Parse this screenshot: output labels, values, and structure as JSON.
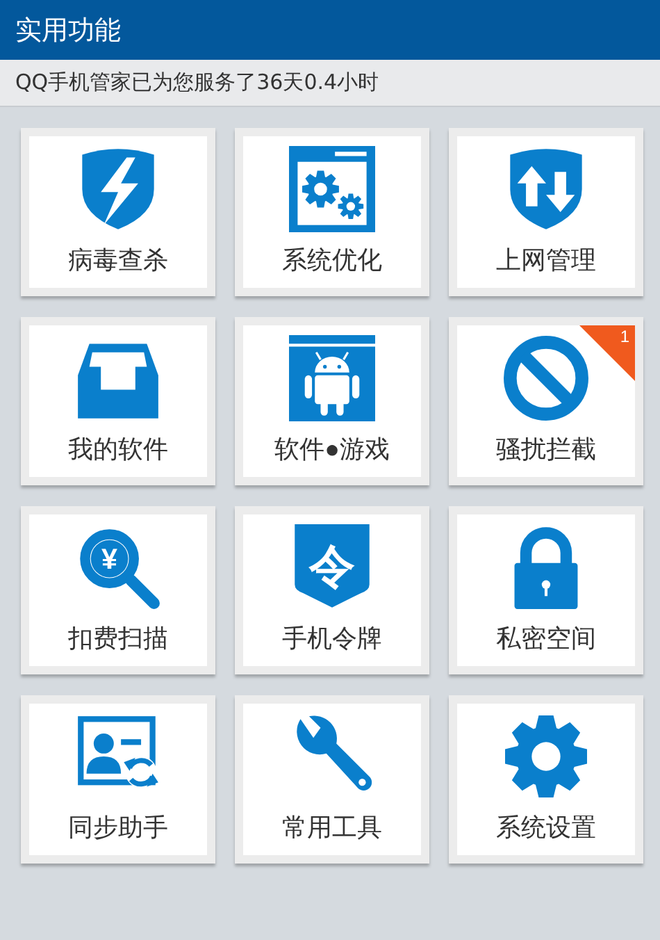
{
  "header": {
    "title": "实用功能"
  },
  "service_note": "QQ手机管家已为您服务了36天0.4小时",
  "tiles": [
    {
      "label": "病毒查杀"
    },
    {
      "label": "系统优化"
    },
    {
      "label": "上网管理"
    },
    {
      "label": "我的软件"
    },
    {
      "label": "软件●游戏"
    },
    {
      "label": "骚扰拦截",
      "badge": "1"
    },
    {
      "label": "扣费扫描",
      "icon_text": "¥"
    },
    {
      "label": "手机令牌",
      "icon_text": "令"
    },
    {
      "label": "私密空间"
    },
    {
      "label": "同步助手"
    },
    {
      "label": "常用工具"
    },
    {
      "label": "系统设置"
    }
  ]
}
